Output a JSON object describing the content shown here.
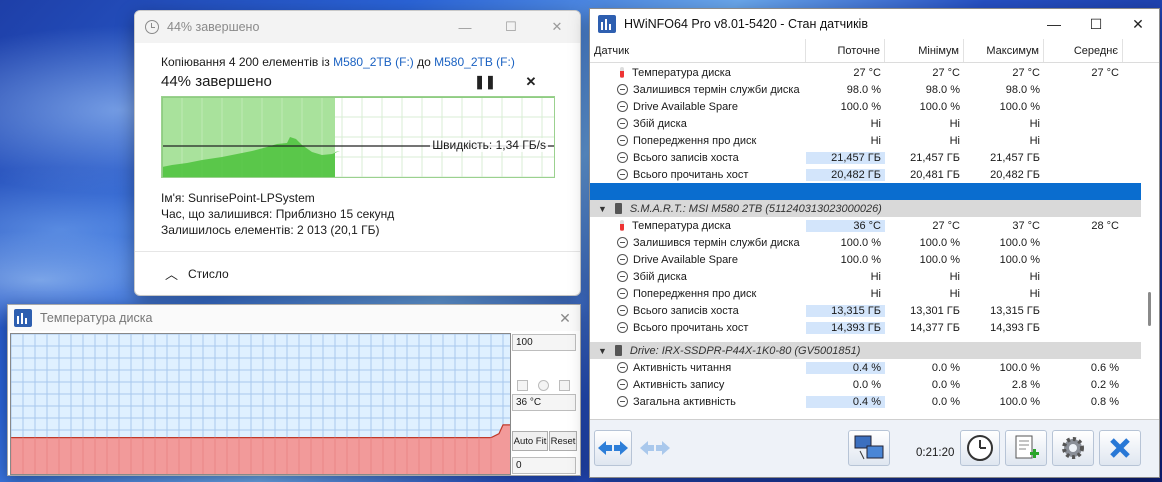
{
  "copy_dialog": {
    "title": "44% завершено",
    "line_prefix": "Копіювання 4 200 елементів із ",
    "source": "M580_2TB (F:)",
    "middle": " до ",
    "dest": "M580_2TB (F:)",
    "status": "44% завершено",
    "progress_pct": 44,
    "speed_label": "Швидкість: 1,34 ГБ/s",
    "name_line": "Ім'я:  SunrisePoint-LPSystem",
    "time_line": "Час, що залишився:  Приблизно 15 секунд",
    "items_line": "Залишилось елементів:  2 013 (20,1 ГБ)",
    "collapse_label": "Стисло",
    "accent_color": "#06b025",
    "link_color": "#1b62c2"
  },
  "temp_window": {
    "title": "Температура диска",
    "max_label": "100",
    "current_label": "36 °C",
    "min_label": "0",
    "autofit_label": "Auto Fit",
    "reset_label": "Reset",
    "current_value": 36
  },
  "hwinfo": {
    "title": "HWiNFO64 Pro v8.01-5420 - Стан датчиків",
    "columns": {
      "name": "Датчик",
      "current": "Поточне",
      "min": "Мінімум",
      "max": "Максимум",
      "avg": "Середнє"
    },
    "rows_top": [
      {
        "icon": "thermometer",
        "name": "Температура диска",
        "cur": "27 °C",
        "min": "27 °C",
        "max": "27 °C",
        "avg": "27 °C"
      },
      {
        "icon": "clock",
        "name": "Залишився термін служби диска",
        "cur": "98.0 %",
        "min": "98.0 %",
        "max": "98.0 %",
        "avg": ""
      },
      {
        "icon": "clock",
        "name": "Drive Available Spare",
        "cur": "100.0 %",
        "min": "100.0 %",
        "max": "100.0 %",
        "avg": ""
      },
      {
        "icon": "clock",
        "name": "Збій диска",
        "cur": "Ні",
        "min": "Ні",
        "max": "Ні",
        "avg": ""
      },
      {
        "icon": "clock",
        "name": "Попередження про диск",
        "cur": "Ні",
        "min": "Ні",
        "max": "Ні",
        "avg": ""
      },
      {
        "icon": "clock",
        "name": "Всього записів хоста",
        "cur": "21,457 ГБ",
        "min": "21,457 ГБ",
        "max": "21,457 ГБ",
        "avg": ""
      },
      {
        "icon": "clock",
        "name": "Всього прочитань хост",
        "cur": "20,482 ГБ",
        "min": "20,481 ГБ",
        "max": "20,482 ГБ",
        "avg": ""
      }
    ],
    "group_smart": "S.M.A.R.T.: MSI M580 2TB (511240313023000026)",
    "rows_smart": [
      {
        "icon": "thermometer",
        "name": "Температура диска",
        "cur": "36 °C",
        "min": "27 °C",
        "max": "37 °C",
        "avg": "28 °C"
      },
      {
        "icon": "clock",
        "name": "Залишився термін служби диска",
        "cur": "100.0 %",
        "min": "100.0 %",
        "max": "100.0 %",
        "avg": ""
      },
      {
        "icon": "clock",
        "name": "Drive Available Spare",
        "cur": "100.0 %",
        "min": "100.0 %",
        "max": "100.0 %",
        "avg": ""
      },
      {
        "icon": "clock",
        "name": "Збій диска",
        "cur": "Ні",
        "min": "Ні",
        "max": "Ні",
        "avg": ""
      },
      {
        "icon": "clock",
        "name": "Попередження про диск",
        "cur": "Ні",
        "min": "Ні",
        "max": "Ні",
        "avg": ""
      },
      {
        "icon": "clock",
        "name": "Всього записів хоста",
        "cur": "13,315 ГБ",
        "min": "13,301 ГБ",
        "max": "13,315 ГБ",
        "avg": ""
      },
      {
        "icon": "clock",
        "name": "Всього прочитань хост",
        "cur": "14,393 ГБ",
        "min": "14,377 ГБ",
        "max": "14,393 ГБ",
        "avg": ""
      }
    ],
    "group_drive": "Drive: IRX-SSDPR-P44X-1K0-80 (GV5001851)",
    "rows_drive": [
      {
        "icon": "clock",
        "name": "Активність читання",
        "cur": "0.4 %",
        "min": "0.0 %",
        "max": "100.0 %",
        "avg": "0.6 %"
      },
      {
        "icon": "clock",
        "name": "Активність запису",
        "cur": "0.0 %",
        "min": "0.0 %",
        "max": "2.8 %",
        "avg": "0.2 %"
      },
      {
        "icon": "clock",
        "name": "Загальна активність",
        "cur": "0.4 %",
        "min": "0.0 %",
        "max": "100.0 %",
        "avg": "0.8 %"
      }
    ],
    "timer": "0:21:20",
    "selection_color": "#0a6dcf"
  }
}
